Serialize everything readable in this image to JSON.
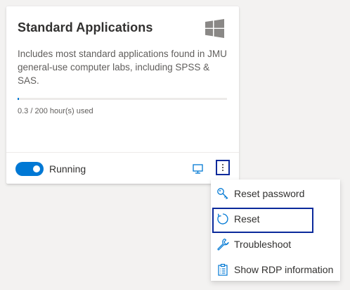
{
  "card": {
    "title": "Standard Applications",
    "description": "Includes most standard applications found in JMU general-use computer labs, including SPSS & SAS.",
    "os_icon": "windows-logo-icon",
    "usage": {
      "text": "0.3 / 200 hour(s) used",
      "used_fraction": 0.0015
    },
    "status": {
      "label": "Running",
      "toggle_on": true
    },
    "actions": {
      "connect_icon": "monitor-icon",
      "more_icon": "more-vertical-icon"
    }
  },
  "menu": {
    "items": [
      {
        "label": "Reset password",
        "icon": "key-icon"
      },
      {
        "label": "Reset",
        "icon": "refresh-icon",
        "focused": true
      },
      {
        "label": "Troubleshoot",
        "icon": "wrench-icon"
      },
      {
        "label": "Show RDP information",
        "icon": "clipboard-icon"
      }
    ]
  },
  "colors": {
    "accent": "#0078d4",
    "focus_border": "#0b2a9b",
    "icon_gray": "#8a8886"
  }
}
